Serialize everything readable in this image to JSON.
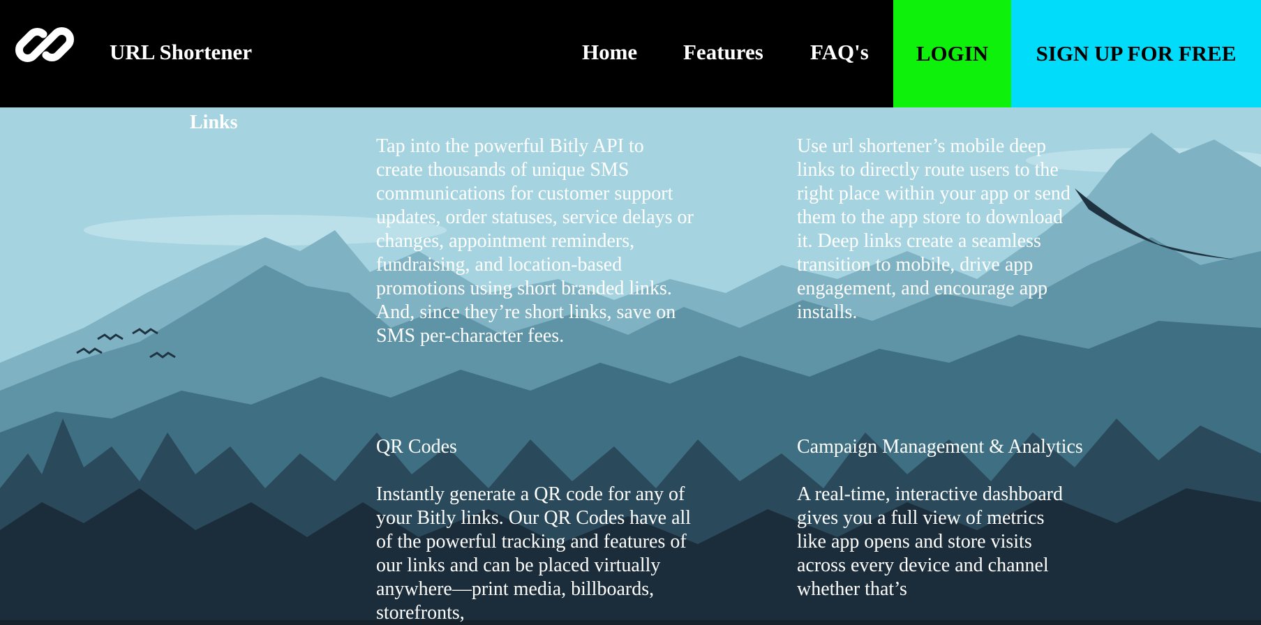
{
  "header": {
    "brand": "URL Shortener",
    "nav": {
      "home": "Home",
      "features": "Features",
      "faq": "FAQ's"
    },
    "login": "LOGIN",
    "signup": "SIGN UP FOR FREE"
  },
  "sidebar": {
    "links_label": "Links"
  },
  "features": {
    "bulk": {
      "body": "Tap into the powerful Bitly API to create thousands of unique SMS communications for customer support updates, order statuses, service delays or changes, appointment reminders, fundraising, and location-based promotions using short branded links. And, since they’re short links, save on SMS per-character fees."
    },
    "deep": {
      "body": "Use url shortener’s mobile deep links to directly route users to the right place within your app or send them to the app store to download it. Deep links create a seamless transition to mobile, drive app engagement, and encourage app installs."
    },
    "qr": {
      "title": "QR Codes",
      "body": "Instantly generate a QR code for any of your Bitly links. Our QR Codes have all of the powerful tracking and features of our links and can be placed virtually anywhere—print media, billboards, storefronts,"
    },
    "campaign": {
      "title": "Campaign Management & Analytics",
      "body": "A real-time, interactive dashboard gives you a full view of metrics like app opens and store visits across every device and channel whether that’s"
    }
  },
  "colors": {
    "header_bg": "#000000",
    "login_bg": "#0ef10a",
    "signup_bg": "#00dcfa",
    "sky": "#a3d3df"
  },
  "icons": {
    "logo": "chain-link-icon"
  }
}
